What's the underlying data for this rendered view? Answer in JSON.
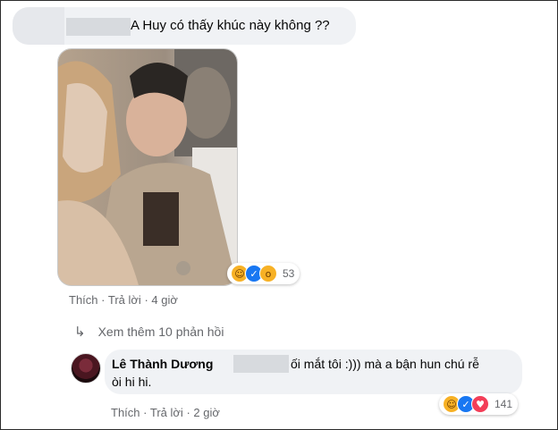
{
  "comment": {
    "text": "A Huy có thấy khúc này không ??",
    "reactions": {
      "icons": [
        "haha-icon",
        "like-icon",
        "wow-icon"
      ],
      "count": "53"
    },
    "actions": {
      "like": "Thích",
      "reply": "Trả lời",
      "time": "4 giờ",
      "separator": "·"
    }
  },
  "see_more": {
    "label": "Xem thêm 10 phản hồi"
  },
  "reply": {
    "author": "Lê Thành Dương",
    "line1": "ối mắt tôi :))) mà a bận hun chú rễ",
    "line2": "òi hi hi.",
    "reactions": {
      "icons": [
        "haha-icon",
        "like-icon",
        "love-icon"
      ],
      "count": "141"
    },
    "actions": {
      "like": "Thích",
      "reply": "Trả lời",
      "time": "2 giờ",
      "separator": "·"
    }
  },
  "colors": {
    "bubble": "#f0f2f5",
    "meta_text": "#65676b",
    "like_blue": "#1877f2",
    "love_red": "#f33e58",
    "haha_yellow": "#f7b125"
  }
}
